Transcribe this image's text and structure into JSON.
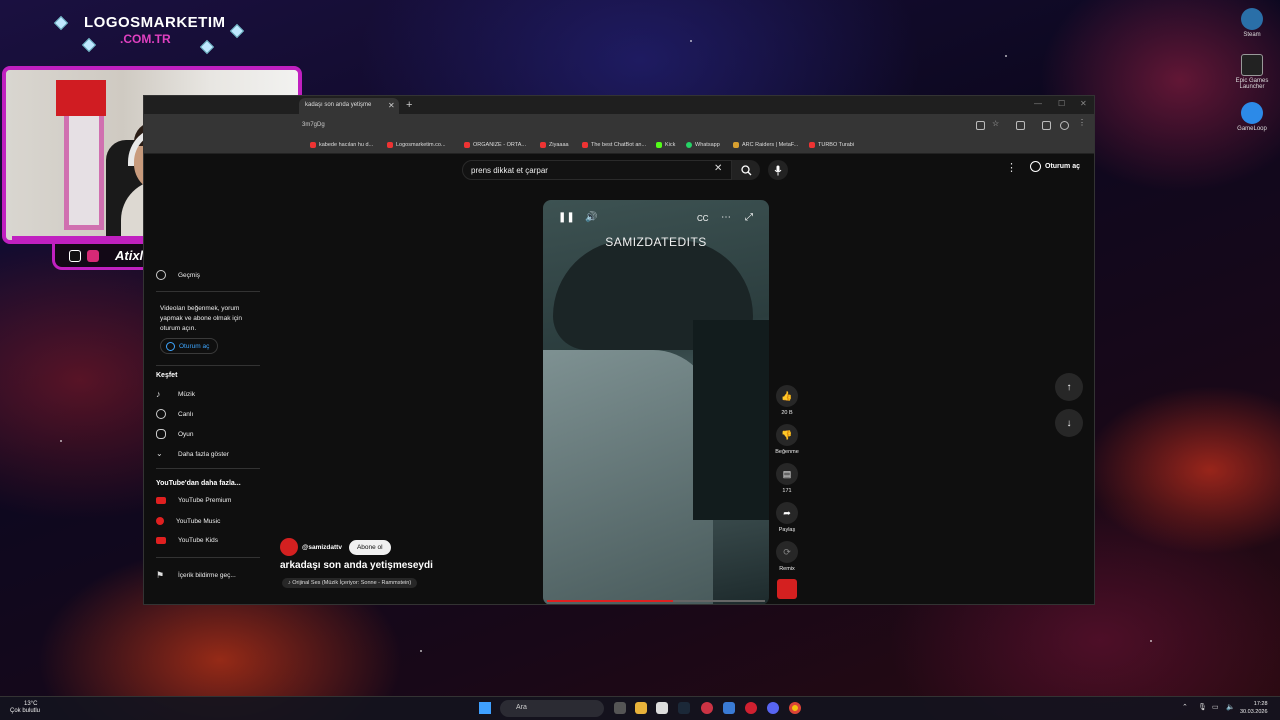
{
  "overlay": {
    "brand_title": "LOGOSMARKETIM",
    "brand_sub": ".COM.TR",
    "streamer_name": "Atixlive"
  },
  "desktop_icons": [
    {
      "name": "steam-icon",
      "label": "Steam",
      "color": "#2a6fa8"
    },
    {
      "name": "epic-games-icon",
      "label": "Epic Games Launcher",
      "color": "#222222"
    },
    {
      "name": "gameloop-icon",
      "label": "GameLoop",
      "color": "#2c8ae8"
    }
  ],
  "browser": {
    "tab_title": "kadaşı son anda yetişme",
    "url": "3m7gDg",
    "bookmarks": [
      "kabede hacılan hu d...",
      "Logosmarketim.co...",
      "ORGANIZE - ORTA...",
      "Ziyaaaa",
      "The best ChatBot an...",
      "Kick",
      "Whatsapp",
      "ARC Raiders | MetaF...",
      "TURBO Turabi"
    ]
  },
  "youtube": {
    "search_value": "prens dikkat et çarpar",
    "signin_label": "Oturum aç",
    "sidebar": {
      "history": "Geçmiş",
      "signin_note": "Videoları beğenmek, yorum yapmak ve abone olmak için oturum açın.",
      "signin_button": "Oturum aç",
      "explore_heading": "Keşfet",
      "explore_items": [
        "Müzik",
        "Canlı",
        "Oyun",
        "Daha fazla göster"
      ],
      "more_heading": "YouTube'dan daha fazla...",
      "more_items": [
        "YouTube Premium",
        "YouTube Music",
        "YouTube Kids"
      ],
      "report": "İçerik bildirme geç..."
    },
    "video": {
      "overlay_text": "SAMIZDATEDITS",
      "progress_pct": 58,
      "channel": "@samizdattv",
      "subscribe": "Abone ol",
      "title": "arkadaşı son anda yetişmeseydi",
      "audio": "Orijinal Ses (Müzik İçeriyor: Sonne - Rammstein)"
    },
    "actions": {
      "like_count": "20 B",
      "dislike_label": "Beğenme",
      "comment_count": "171",
      "share_label": "Paylaş",
      "remix_label": "Remix"
    }
  },
  "taskbar": {
    "weather_temp": "13°C",
    "weather_desc": "Çok bulutlu",
    "search_placeholder": "Ara",
    "time": "17:28",
    "date": "30.03.2026"
  }
}
